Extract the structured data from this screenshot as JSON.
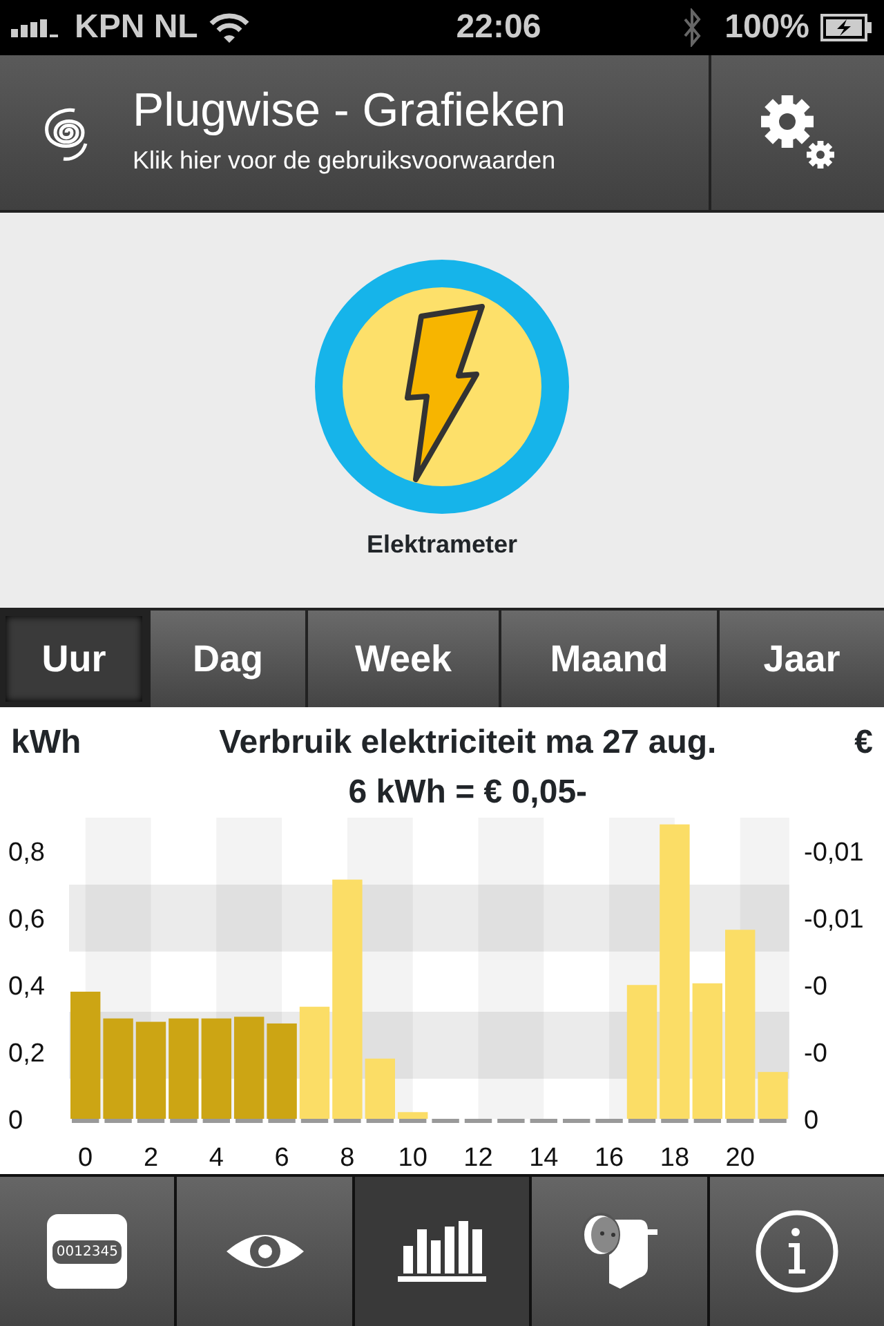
{
  "status_bar": {
    "carrier": "KPN NL",
    "time": "22:06",
    "battery": "100%"
  },
  "header": {
    "title": "Plugwise - Grafieken",
    "subtitle": "Klik hier voor de gebruiksvoorwaarden"
  },
  "device": {
    "label": "Elektrameter"
  },
  "segments": [
    {
      "label": "Uur",
      "selected": true
    },
    {
      "label": "Dag",
      "selected": false
    },
    {
      "label": "Week",
      "selected": false
    },
    {
      "label": "Maand",
      "selected": false
    },
    {
      "label": "Jaar",
      "selected": false
    }
  ],
  "chart": {
    "left_unit": "kWh",
    "title": "Verbruik elektriciteit ma 27 aug.",
    "subtitle": "6 kWh = € 0,05-",
    "right_unit": "€",
    "right_labels": [
      "-0,01",
      "-0,01",
      "-0",
      "-0",
      "0"
    ],
    "chart_data": {
      "type": "bar",
      "x": [
        0,
        1,
        2,
        3,
        4,
        5,
        6,
        7,
        8,
        9,
        10,
        11,
        12,
        13,
        14,
        15,
        16,
        17,
        18,
        19,
        20,
        21
      ],
      "stacked": true,
      "series": [
        {
          "color": "#cca514",
          "values": [
            0.38,
            0.3,
            0.29,
            0.3,
            0.3,
            0.305,
            0.285,
            null,
            null,
            null,
            null,
            null,
            null,
            null,
            null,
            null,
            null,
            null,
            null,
            null,
            null,
            null
          ]
        },
        {
          "color": "#fbdd66",
          "values": [
            null,
            null,
            null,
            null,
            null,
            null,
            null,
            0.335,
            0.715,
            0.18,
            0.02,
            0,
            0,
            0,
            0,
            0,
            0,
            0.4,
            0.88,
            0.405,
            0.565,
            0.14
          ]
        }
      ],
      "bands": [
        {
          "axis": "x",
          "from": 0,
          "to": 2,
          "color": "#f3f3f3"
        },
        {
          "axis": "x",
          "from": 4,
          "to": 6,
          "color": "#f3f3f3"
        },
        {
          "axis": "x",
          "from": 8,
          "to": 10,
          "color": "#f3f3f3"
        },
        {
          "axis": "x",
          "from": 12,
          "to": 14,
          "color": "#f3f3f3"
        },
        {
          "axis": "x",
          "from": 16,
          "to": 18,
          "color": "#f3f3f3"
        },
        {
          "axis": "x",
          "from": 20,
          "to": 21.5,
          "color": "#f3f3f3"
        },
        {
          "axis": "y",
          "from": 0.5,
          "to": 0.7,
          "color": "#ebebeb"
        },
        {
          "axis": "y",
          "from": 0.12,
          "to": 0.32,
          "color": "#ebebeb"
        }
      ],
      "xlim": [
        -0.5,
        21.5
      ],
      "ylim": [
        0,
        0.9
      ],
      "yticks": [
        {
          "value": 0,
          "label": "0"
        },
        {
          "value": 0.2,
          "label": "0,2"
        },
        {
          "value": 0.4,
          "label": "0,4"
        },
        {
          "value": 0.6,
          "label": "0,6"
        },
        {
          "value": 0.8,
          "label": "0,8"
        }
      ],
      "xticks": [
        0,
        2,
        4,
        6,
        8,
        10,
        12,
        14,
        16,
        18,
        20
      ]
    }
  },
  "tab_bar": [
    {
      "kind": "meter",
      "display": "0012345",
      "selected": false
    },
    {
      "kind": "eye",
      "selected": false
    },
    {
      "kind": "bars",
      "selected": true
    },
    {
      "kind": "plug",
      "selected": false
    },
    {
      "kind": "info",
      "selected": false
    }
  ]
}
